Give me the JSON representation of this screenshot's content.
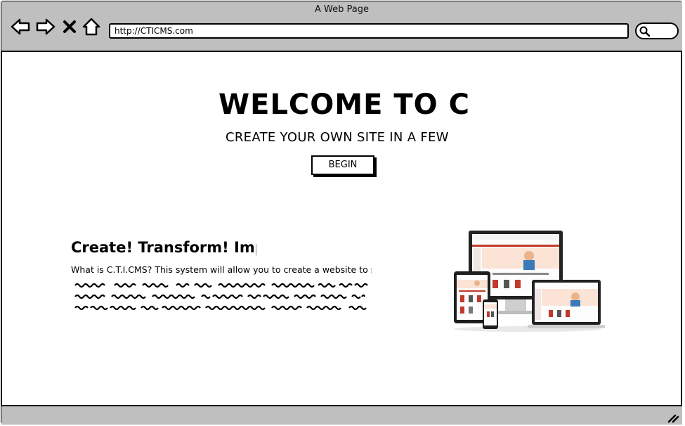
{
  "browser": {
    "window_title": "A Web Page",
    "url": "http://CTICMS.com",
    "icons": [
      "back-arrow-icon",
      "forward-arrow-icon",
      "close-icon",
      "home-icon",
      "search-icon"
    ]
  },
  "hero": {
    "title": "WELCOME TO C.T.I",
    "subtitle": "CREATE YOUR OWN SITE IN A FEW",
    "begin_label": "BEGIN"
  },
  "feature": {
    "title": "Create! Transform! Imp",
    "description": "What is C.T.I.CMS? This system will allow you to create a website to solv"
  },
  "colors": {
    "chrome": "#bfbfbf",
    "border": "#000000",
    "accent_red": "#c0392b"
  }
}
